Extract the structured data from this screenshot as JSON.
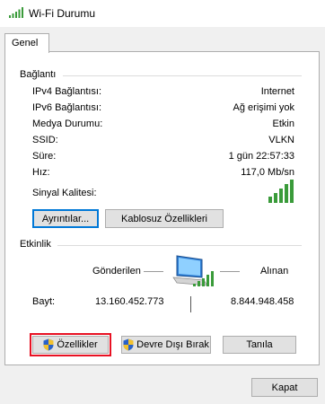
{
  "window": {
    "title": "Wi-Fi Durumu"
  },
  "tabs": [
    {
      "label": "Genel"
    }
  ],
  "connection": {
    "section_title": "Bağlantı",
    "rows": [
      {
        "label": "IPv4 Bağlantısı:",
        "value": "Internet"
      },
      {
        "label": "IPv6 Bağlantısı:",
        "value": "Ağ erişimi yok"
      },
      {
        "label": "Medya Durumu:",
        "value": "Etkin"
      },
      {
        "label": "SSID:",
        "value": "VLKN"
      },
      {
        "label": "Süre:",
        "value": "1 gün 22:57:33"
      },
      {
        "label": "Hız:",
        "value": "117,0 Mb/sn"
      }
    ],
    "signal_label": "Sinyal Kalitesi:",
    "signal_bars_filled": 5,
    "signal_bars_total": 5,
    "details_button": "Ayrıntılar...",
    "wireless_props_button": "Kablosuz Özellikleri"
  },
  "activity": {
    "section_title": "Etkinlik",
    "sent_label": "Gönderilen",
    "received_label": "Alınan",
    "bytes_label": "Bayt:",
    "bytes_sent": "13.160.452.773",
    "bytes_received": "8.844.948.458"
  },
  "actions": {
    "properties_button": "Özellikler",
    "disable_button": "Devre Dışı Bırak",
    "diagnose_button": "Tanıla"
  },
  "footer": {
    "close_button": "Kapat"
  },
  "colors": {
    "signal_green": "#3a9b3a",
    "focus_blue": "#0078d7",
    "highlight_red": "#e81123",
    "shield_blue": "#2a62c9",
    "shield_yellow": "#f2c12e"
  }
}
